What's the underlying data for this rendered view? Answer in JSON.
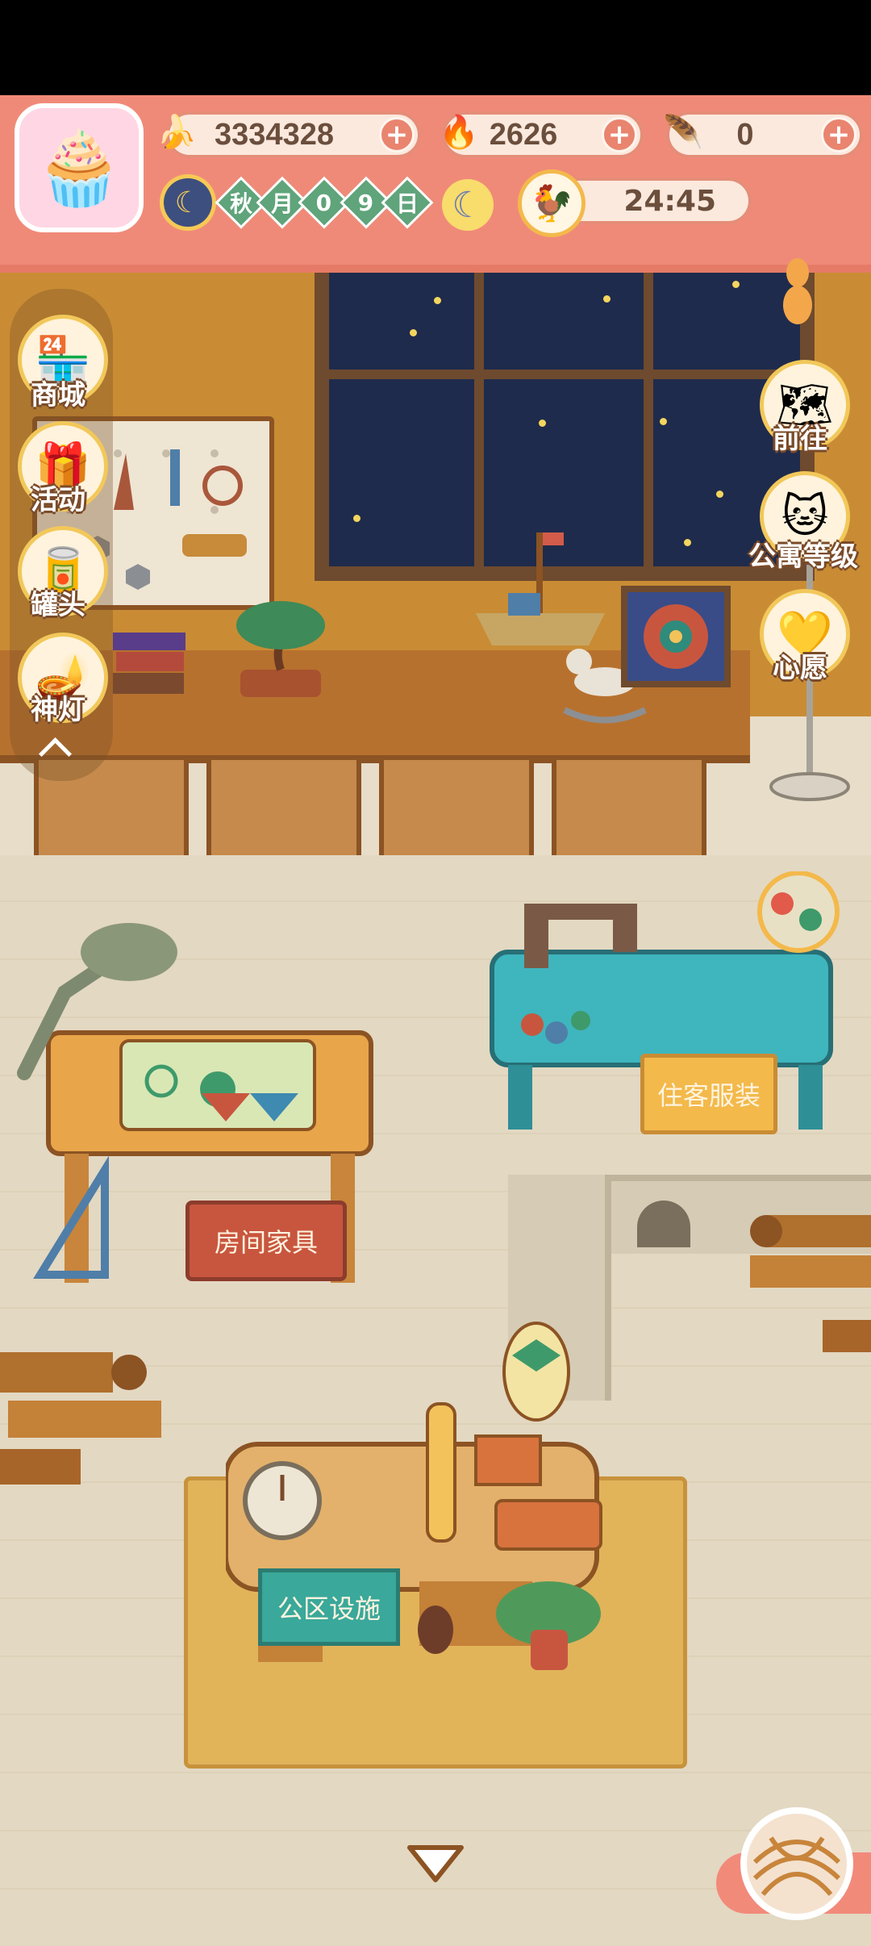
{
  "hud": {
    "bananas": "3334328",
    "flames": "2626",
    "feathers": "0",
    "season_chars": [
      "秋",
      "月",
      "0",
      "9",
      "日"
    ],
    "time": "24:45"
  },
  "side_menu": [
    {
      "label": "商城",
      "icon": "shop-icon"
    },
    {
      "label": "活动",
      "icon": "gift-icon"
    },
    {
      "label": "罐头",
      "icon": "can-icon"
    },
    {
      "label": "神灯",
      "icon": "magic-lamp-icon"
    }
  ],
  "right_menu": [
    {
      "label": "前往",
      "icon": "map-icon"
    },
    {
      "label": "公寓等级",
      "icon": "cat-badge-icon"
    },
    {
      "label": "心愿",
      "icon": "heart-book-icon"
    }
  ],
  "stations": {
    "room_furniture": "房间家具",
    "guest_clothing": "住客服装",
    "public_facilities": "公区设施"
  },
  "colors": {
    "hud_bg": "#f08a78",
    "wall": "#c98c34",
    "floor": "#e3d8c2"
  }
}
